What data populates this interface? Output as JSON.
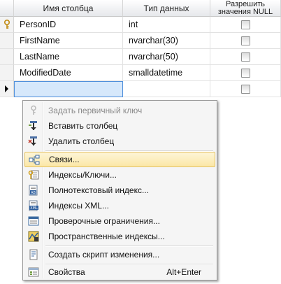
{
  "grid": {
    "headers": {
      "column_name": "Имя столбца",
      "data_type": "Тип данных",
      "allow_nulls_line1": "Разрешить",
      "allow_nulls_line2": "значения NULL"
    },
    "rows": [
      {
        "name": "PersonID",
        "type": "int",
        "primary_key": true,
        "allow_null": false
      },
      {
        "name": "FirstName",
        "type": "nvarchar(30)",
        "primary_key": false,
        "allow_null": false
      },
      {
        "name": "LastName",
        "type": "nvarchar(50)",
        "primary_key": false,
        "allow_null": false
      },
      {
        "name": "ModifiedDate",
        "type": "smalldatetime",
        "primary_key": false,
        "allow_null": false
      }
    ],
    "new_row": {
      "name": "",
      "type": "",
      "allow_null": false
    }
  },
  "menu": {
    "items": [
      {
        "label": "Задать первичный ключ",
        "icon": "key-icon",
        "disabled": true
      },
      {
        "label": "Вставить столбец",
        "icon": "insert-column-icon"
      },
      {
        "label": "Удалить столбец",
        "icon": "delete-column-icon"
      },
      {
        "label": "Связи...",
        "icon": "relationships-icon",
        "highlighted": true
      },
      {
        "label": "Индексы/Ключи...",
        "icon": "indexes-keys-icon"
      },
      {
        "label": "Полнотекстовый индекс...",
        "icon": "fulltext-index-icon"
      },
      {
        "label": "Индексы XML...",
        "icon": "xml-indexes-icon"
      },
      {
        "label": "Проверочные ограничения...",
        "icon": "check-constraints-icon"
      },
      {
        "label": "Пространственные индексы...",
        "icon": "spatial-indexes-icon"
      },
      {
        "label": "Создать скрипт изменения...",
        "icon": "generate-script-icon"
      },
      {
        "label": "Свойства",
        "icon": "properties-icon",
        "shortcut": "Alt+Enter"
      }
    ]
  },
  "colors": {
    "menu_highlight": "#fbe7a6",
    "new_row_fill": "#d6e8fb",
    "key_gold": "#d4a017"
  }
}
